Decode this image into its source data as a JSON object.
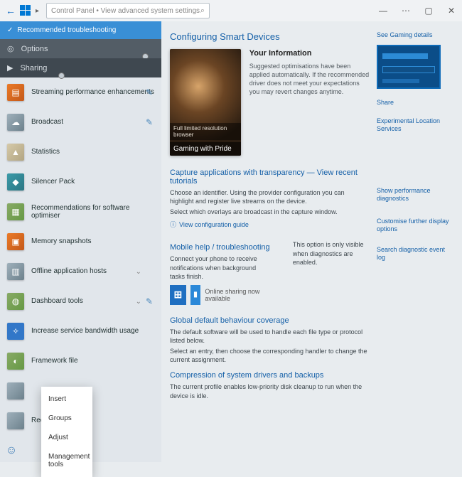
{
  "titlebar": {
    "search_placeholder": "Control Panel • View advanced system settings",
    "win_min": "—",
    "win_max": "▢",
    "win_more": "⋯",
    "win_close": "✕"
  },
  "sidebar": {
    "header": "Recommended troubleshooting",
    "dark_items": [
      {
        "icon": "◎",
        "label": "Options"
      },
      {
        "icon": "▶",
        "label": "Sharing"
      }
    ],
    "rows": [
      {
        "icon_cls": "orange",
        "glyph": "▤",
        "label": "Streaming performance enhancements",
        "pin": true
      },
      {
        "icon_cls": "grey",
        "glyph": "☁",
        "label": "Broadcast",
        "pin": true
      },
      {
        "icon_cls": "sand",
        "glyph": "▲",
        "label": "Statistics"
      },
      {
        "icon_cls": "teal",
        "glyph": "◆",
        "label": "Silencer Pack"
      },
      {
        "icon_cls": "img",
        "glyph": "▦",
        "label": "Recommendations for software optimiser"
      },
      {
        "icon_cls": "orange",
        "glyph": "▣",
        "label": "Memory snapshots"
      },
      {
        "icon_cls": "grey",
        "glyph": "▥",
        "label": "Offline application hosts",
        "chev": true
      },
      {
        "icon_cls": "img",
        "glyph": "◍",
        "label": "Dashboard tools",
        "chev": true,
        "pin": true
      },
      {
        "icon_cls": "blue2",
        "glyph": "✧",
        "label": "Increase service bandwidth usage"
      },
      {
        "icon_cls": "img",
        "glyph": "◐",
        "label": "Framework file"
      },
      {
        "icon_cls": "grey",
        "glyph": "",
        "label": ""
      },
      {
        "icon_cls": "grey",
        "glyph": "",
        "label": "Recommended"
      }
    ]
  },
  "context_menu": [
    "Insert",
    "Groups",
    "Adjust",
    "Management tools"
  ],
  "main": {
    "title": "Configuring Smart Devices",
    "hero_band": "Full limited resolution browser",
    "hero_title": "Gaming with Pride",
    "intro_heading": "Your Information",
    "intro_body": "Suggested optimisations have been applied automatically. If the recommended driver does not meet your expectations you may revert changes anytime.",
    "sec1_h": "Capture applications with transparency — View recent tutorials",
    "sec1_b1": "Choose an identifier. Using the provider configuration you can highlight and register live streams on the device.",
    "sec1_b2": "Select which overlays are broadcast in the capture window.",
    "sec1_link": "View configuration guide",
    "sec2_h": "Mobile help / troubleshooting",
    "sec2_aside": "This option is only visible when diagnostics are enabled.",
    "sec2_b": "Connect your phone to receive notifications when background tasks finish.",
    "sec2_cap": "Online sharing now available",
    "sec3_h": "Global default behaviour coverage",
    "sec3_b1": "The default software will be used to handle each file type or protocol listed below.",
    "sec3_b2": "Select an entry, then choose the corresponding handler to change the current assignment.",
    "sec4_h": "Compression of system drivers and backups",
    "sec4_b": "The current profile enables low-priority disk cleanup to run when the device is idle."
  },
  "rightcol": {
    "l1": "See Gaming details",
    "l2": "Share",
    "l3": "Experimental Location Services",
    "l4": "Show performance diagnostics",
    "l5": "Customise further display options",
    "l6": "Search diagnostic event log"
  }
}
